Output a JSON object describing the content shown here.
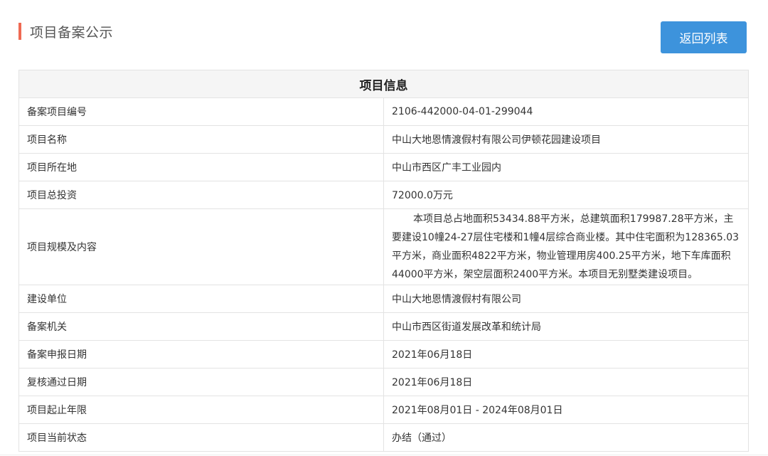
{
  "header": {
    "title": "项目备案公示",
    "back_label": "返回列表",
    "accent_color": "#ef6a53",
    "button_color": "#3d93dc"
  },
  "table": {
    "title": "项目信息",
    "rows": [
      {
        "label": "备案项目编号",
        "value": "2106-442000-04-01-299044"
      },
      {
        "label": "项目名称",
        "value": "中山大地恩情渡假村有限公司伊顿花园建设项目"
      },
      {
        "label": "项目所在地",
        "value": "中山市西区广丰工业园内"
      },
      {
        "label": "项目总投资",
        "value": "72000.0万元"
      },
      {
        "label": "项目规模及内容",
        "value": "本项目总占地面积53434.88平方米，总建筑面积179987.28平方米，主要建设10幢24-27层住宅楼和1幢4层综合商业楼。其中住宅面积为128365.03平方米，商业面积4822平方米，物业管理用房400.25平方米，地下车库面积44000平方米，架空层面积2400平方米。本项目无别墅类建设项目。"
      },
      {
        "label": "建设单位",
        "value": "中山大地恩情渡假村有限公司"
      },
      {
        "label": "备案机关",
        "value": "中山市西区街道发展改革和统计局"
      },
      {
        "label": "备案申报日期",
        "value": "2021年06月18日"
      },
      {
        "label": "复核通过日期",
        "value": "2021年06月18日"
      },
      {
        "label": "项目起止年限",
        "value": "2021年08月01日 - 2024年08月01日"
      },
      {
        "label": "项目当前状态",
        "value": "办结（通过）"
      }
    ]
  }
}
